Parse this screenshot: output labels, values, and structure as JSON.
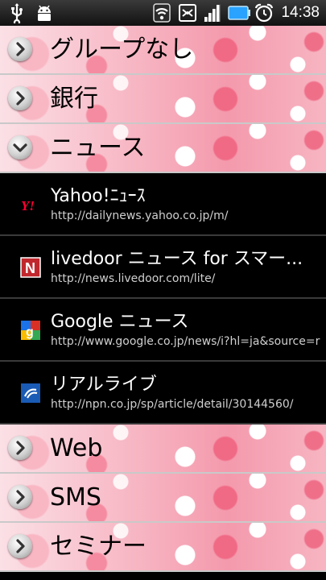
{
  "status_bar": {
    "time": "14:38",
    "icons": [
      "usb-icon",
      "android-debug-icon",
      "wifi-icon",
      "sim-icon",
      "signal-icon",
      "battery-icon",
      "alarm-icon"
    ]
  },
  "groups": [
    {
      "label": "グループなし",
      "expanded": false
    },
    {
      "label": "銀行",
      "expanded": false
    },
    {
      "label": "ニュース",
      "expanded": true
    },
    {
      "label": "Web",
      "expanded": false
    },
    {
      "label": "SMS",
      "expanded": false
    },
    {
      "label": "セミナー",
      "expanded": false
    }
  ],
  "news_items": [
    {
      "title": "Yahoo!ﾆｭｰｽ",
      "url": "http://dailynews.yahoo.co.jp/m/",
      "icon": "yahoo-favicon"
    },
    {
      "title": "livedoor ニュース for スマー...",
      "url": "http://news.livedoor.com/lite/",
      "icon": "livedoor-favicon"
    },
    {
      "title": "Google ニュース",
      "url": "http://www.google.co.jp/news/i?hl=ja&source=r",
      "icon": "google-favicon"
    },
    {
      "title": "リアルライブ",
      "url": "http://npn.co.jp/sp/article/detail/30144560/",
      "icon": "npn-favicon"
    }
  ],
  "colors": {
    "expanded_bg": "#000000",
    "group_pink": "#f49aad",
    "yahoo_red": "#ff0033",
    "livedoor_red": "#c1272d",
    "npn_blue": "#1a5bb5"
  }
}
